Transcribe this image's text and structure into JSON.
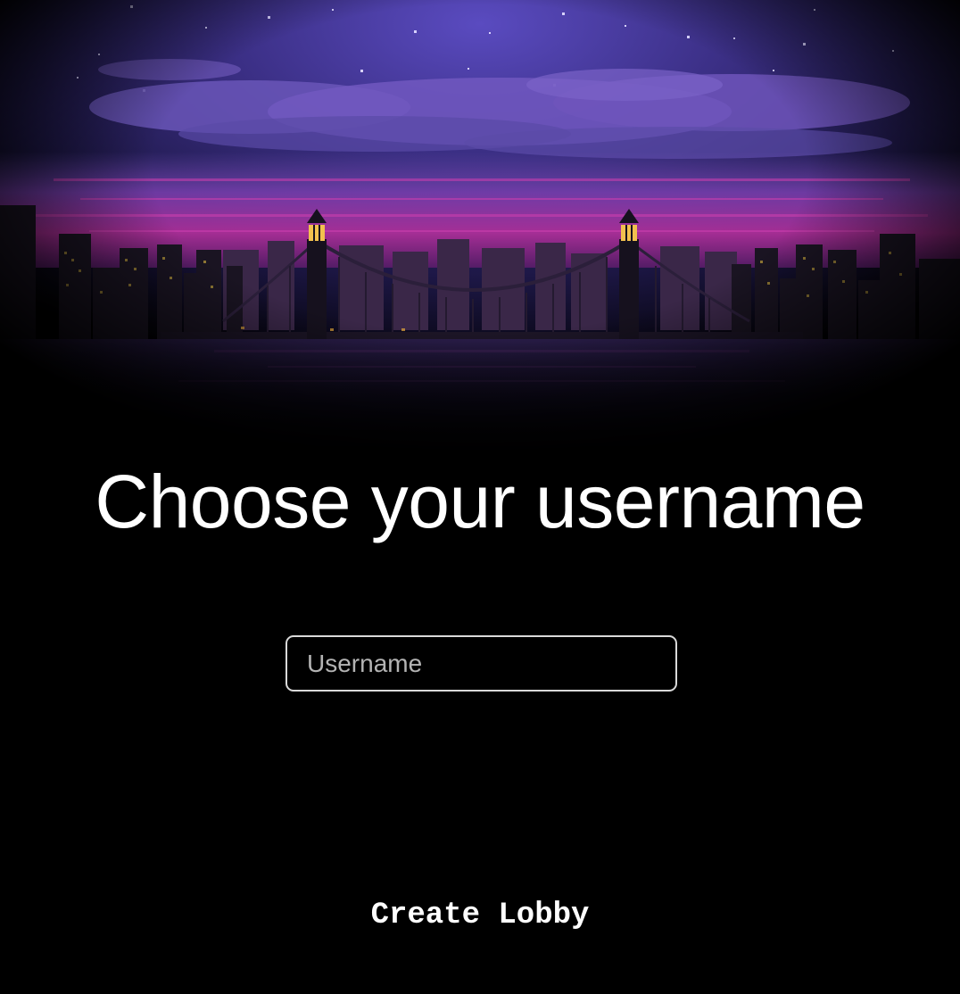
{
  "page": {
    "title": "Choose your username"
  },
  "form": {
    "username_placeholder": "Username",
    "username_value": ""
  },
  "actions": {
    "create_lobby_label": "Create Lobby"
  },
  "theme": {
    "background": "#000000",
    "sky_top": "#4a3fa0",
    "horizon_magenta": "#b0309a",
    "lamp_color": "#f2c14e"
  },
  "hero_image": {
    "description_icon": "pixel-city-bridge-night-illustration"
  }
}
